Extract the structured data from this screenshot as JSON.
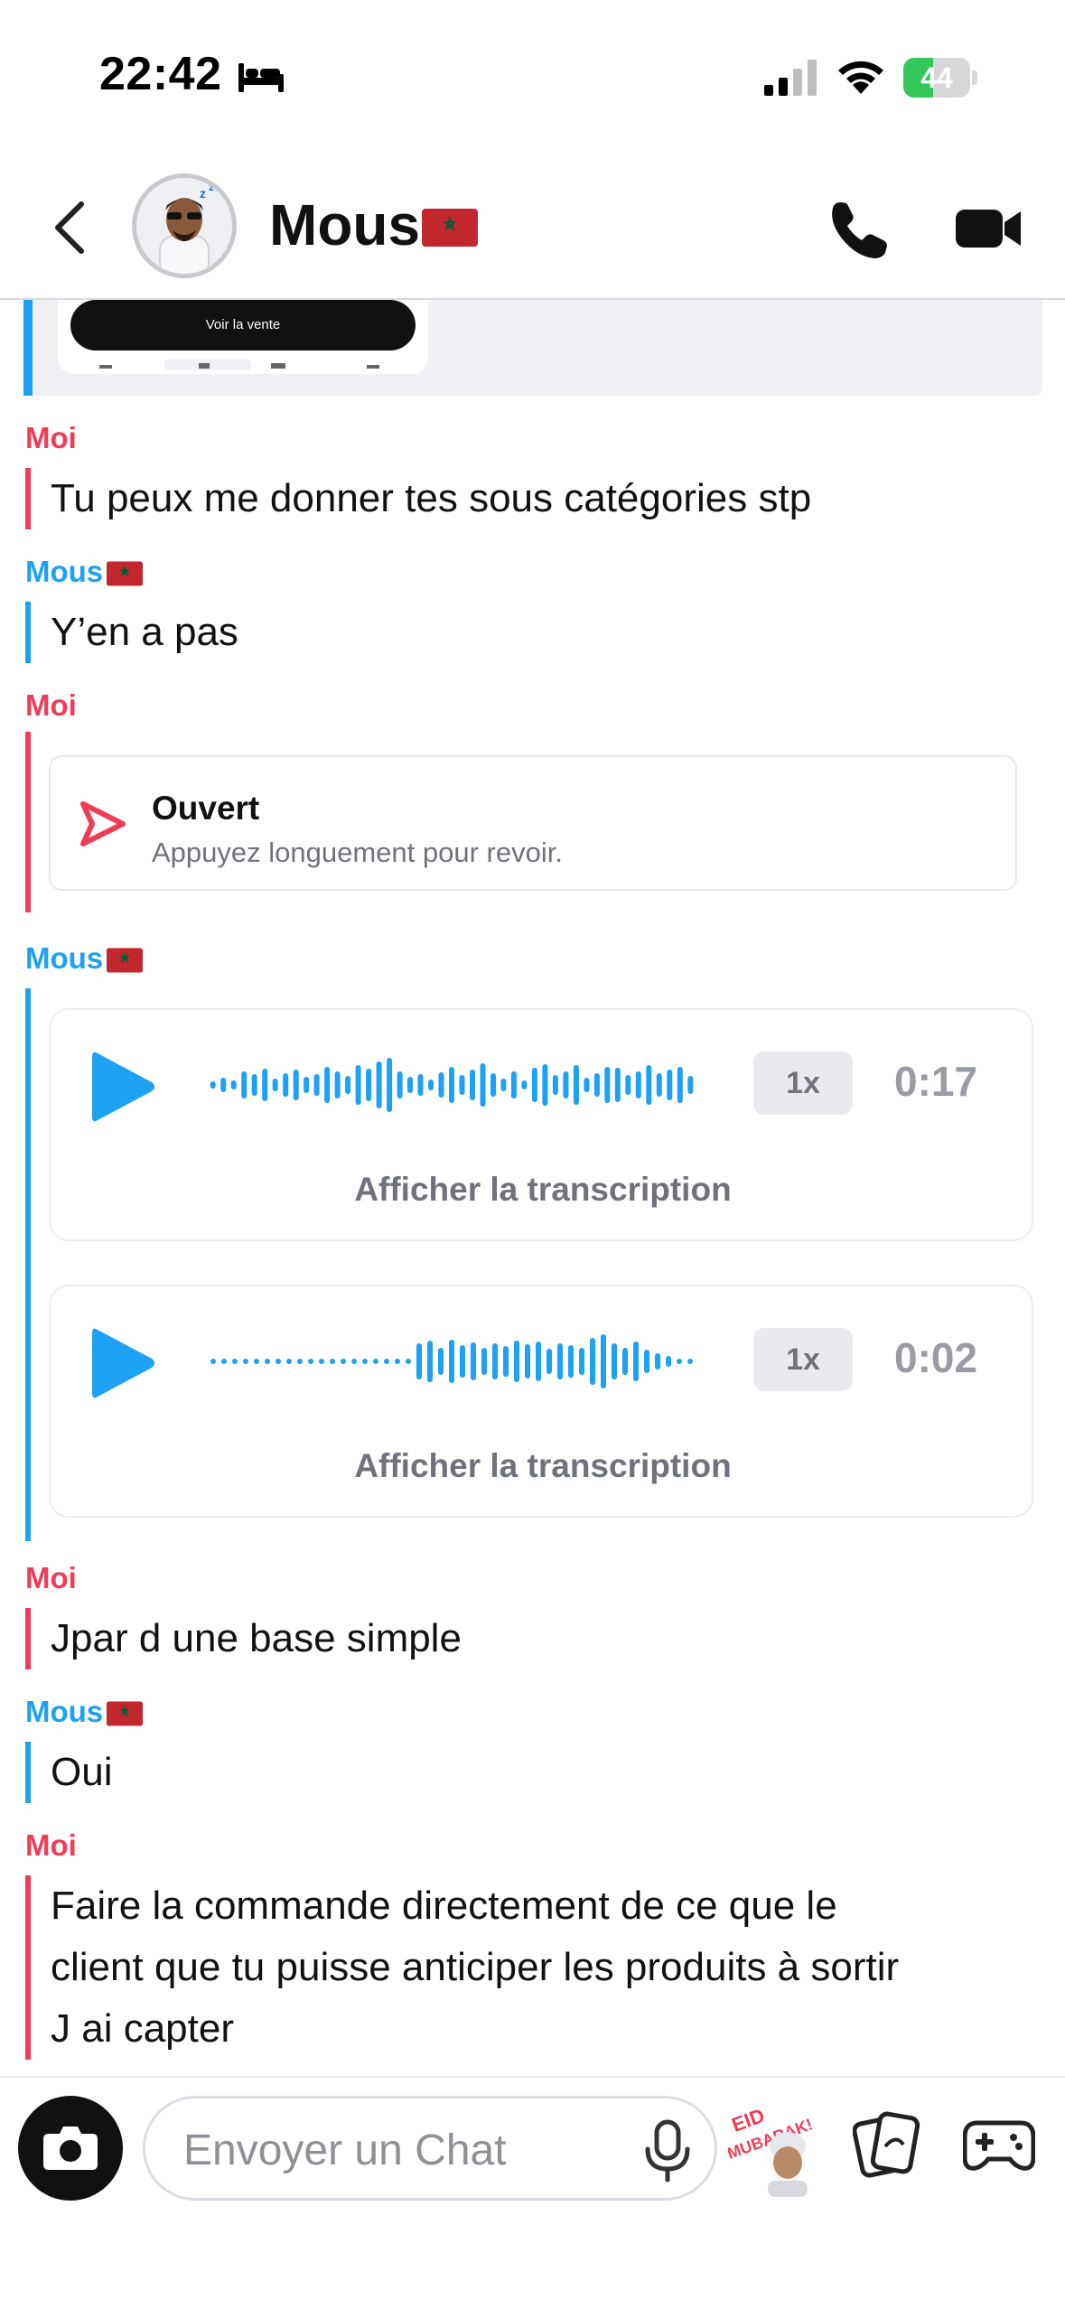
{
  "status_bar": {
    "time": "22:42",
    "battery_level": "44",
    "battery_fraction": 0.44
  },
  "header": {
    "contact_name": "Mous",
    "back_icon": "chevron-left-icon",
    "call_icon": "phone-icon",
    "video_icon": "video-camera-icon"
  },
  "shared_card": {
    "button_label": "Voir la vente"
  },
  "messages": [
    {
      "sender": "Moi",
      "text": "Tu peux me donner tes sous catégories stp"
    },
    {
      "sender": "Mous",
      "text": "Y’en a pas"
    },
    {
      "sender": "Moi",
      "opened_title": "Ouvert",
      "opened_subtitle": "Appuyez longuement pour revoir."
    },
    {
      "sender": "Mous",
      "voice_notes": [
        {
          "speed": "1x",
          "duration": "0:17",
          "transcript_label": "Afficher la transcription"
        },
        {
          "speed": "1x",
          "duration": "0:02",
          "transcript_label": "Afficher la transcription"
        }
      ]
    },
    {
      "sender": "Moi",
      "text": "Jpar d une base simple"
    },
    {
      "sender": "Mous",
      "text": "Oui"
    },
    {
      "sender": "Moi",
      "lines": [
        "Faire la commande directement de ce que le",
        "client que tu puisse anticiper les produits à sortir",
        "J ai capter"
      ]
    }
  ],
  "composer": {
    "placeholder": "Envoyer un Chat",
    "sticker_text": "EID MUBARAK!"
  },
  "colors": {
    "me": "#f23c57",
    "them": "#1da1f2",
    "battery": "#34c759"
  }
}
